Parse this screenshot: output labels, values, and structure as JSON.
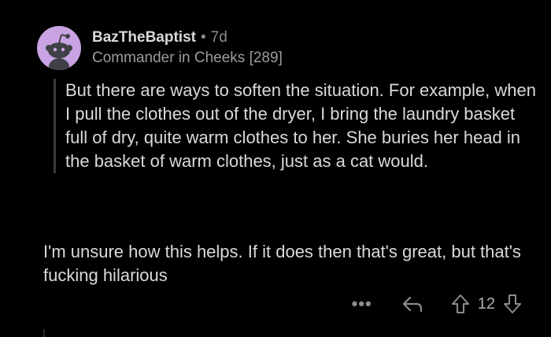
{
  "comment": {
    "username": "BazTheBaptist",
    "separator": "•",
    "age": "7d",
    "flair": "Commander in Cheeks [289]",
    "quote": "But there are ways to soften the situation. For example, when I pull the clothes out of the dryer, I bring the laundry basket full of dry, quite warm clothes to her. She buries her head in the basket of warm clothes, just as a cat would.",
    "body": "I'm unsure how this helps. If it does then that's great, but that's fucking hilarious",
    "actions": {
      "more_label": "•••",
      "vote_count": "12"
    }
  },
  "colors": {
    "background": "#000000",
    "avatar_bg": "#c9a3e3",
    "text": "#d7dadc",
    "muted": "#8a8c8e"
  },
  "icons": [
    "avatar-snoo-icon",
    "reply-icon",
    "upvote-icon",
    "downvote-icon"
  ]
}
